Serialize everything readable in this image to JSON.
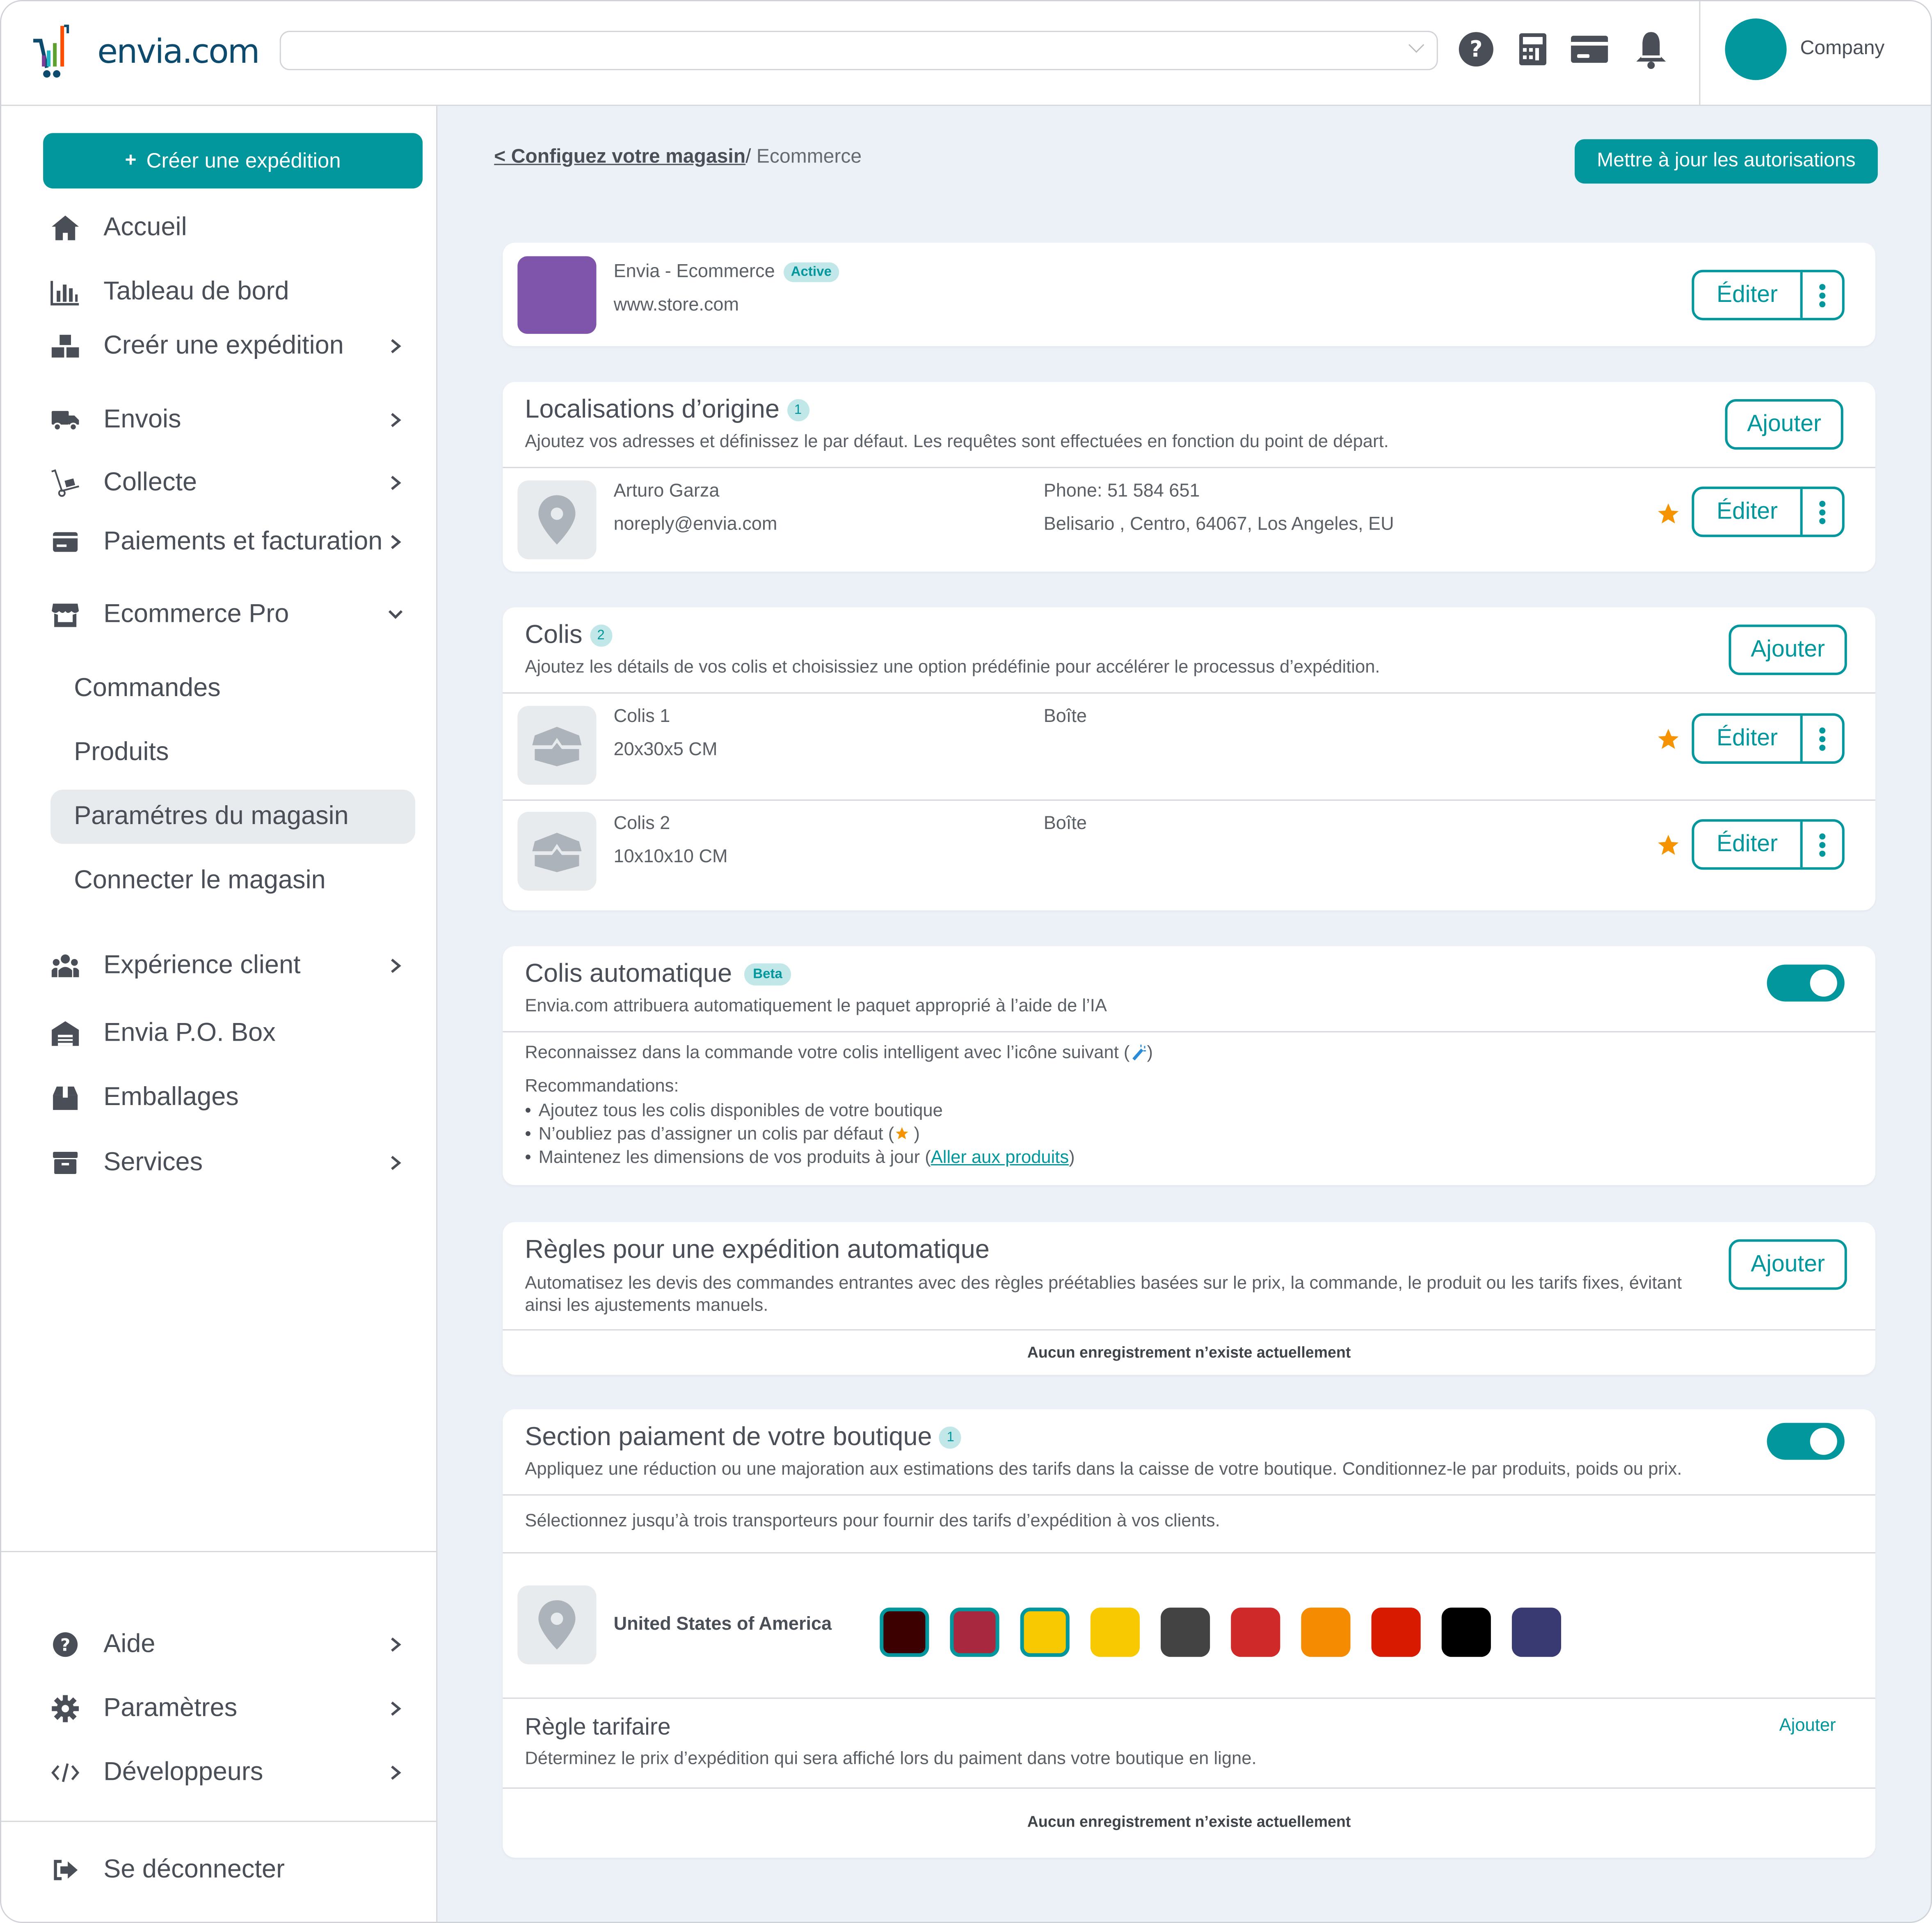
{
  "header": {
    "logo_text": "envia.com",
    "search": {
      "value": "",
      "placeholder": ""
    },
    "icons": [
      "help-circle-icon",
      "calculator-icon",
      "credit-card-icon",
      "bell-icon"
    ],
    "user_label": "Company",
    "avatar_color": "#02979c"
  },
  "sidebar": {
    "create_button": "Créer une expédition",
    "items": [
      {
        "label": "Accueil",
        "icon": "home-icon",
        "has_arrow": false
      },
      {
        "label": "Tableau de bord",
        "icon": "bar-chart-icon",
        "has_arrow": false
      },
      {
        "label": "Creér une expédition",
        "icon": "boxes-icon",
        "has_arrow": true
      },
      {
        "label": "Envois",
        "icon": "truck-icon",
        "has_arrow": true
      },
      {
        "label": "Collecte",
        "icon": "hand-truck-icon",
        "has_arrow": true
      },
      {
        "label": "Paiements et facturation",
        "icon": "credit-card-icon",
        "has_arrow": true
      },
      {
        "label": "Ecommerce Pro",
        "icon": "store-icon",
        "expanded": true
      }
    ],
    "sub_items": [
      {
        "label": "Commandes",
        "active": false
      },
      {
        "label": "Produits",
        "active": false
      },
      {
        "label": "Paramétres du magasin",
        "active": true
      },
      {
        "label": "Connecter le magasin",
        "active": false
      }
    ],
    "items_after": [
      {
        "label": "Expérience client",
        "icon": "users-icon",
        "has_arrow": true
      },
      {
        "label": "Envia P.O. Box",
        "icon": "warehouse-icon",
        "has_arrow": false
      },
      {
        "label": "Emballages",
        "icon": "package-icon",
        "has_arrow": false
      },
      {
        "label": "Services",
        "icon": "archive-icon",
        "has_arrow": true
      }
    ],
    "bottom_items": [
      {
        "label": "Aide",
        "icon": "help-circle-icon"
      },
      {
        "label": "Paramètres",
        "icon": "gear-icon"
      },
      {
        "label": "Développeurs",
        "icon": "code-icon"
      }
    ],
    "logout": "Se déconnecter"
  },
  "breadcrumb": {
    "back": "< Configuez votre magasin",
    "separator": "/ ",
    "current": "Ecommerce"
  },
  "update_permissions_button": "Mettre à jour les autorisations",
  "store": {
    "name": "Envia - Ecommerce",
    "status": "Active",
    "url": "www.store.com",
    "logo_color": "#7e55ab",
    "edit_label": "Éditer"
  },
  "origins": {
    "title": "Localisations d’origine",
    "count": "1",
    "description": "Ajoutez vos adresses et définissez le par défaut. Les requêtes sont effectuées en fonction du point de départ.",
    "add_label": "Ajouter",
    "rows": [
      {
        "name": "Arturo Garza",
        "email": "noreply@envia.com",
        "phone": "Phone: 51 584 651",
        "address": "Belisario , Centro, 64067, Los Angeles, EU",
        "default": true,
        "edit_label": "Éditer"
      }
    ]
  },
  "packages": {
    "title": "Colis",
    "count": "2",
    "description": "Ajoutez les détails de vos colis et choisissiez une option prédéfinie pour accélérer le processus d’expédition.",
    "add_label": "Ajouter",
    "rows": [
      {
        "name": "Colis 1",
        "dims": "20x30x5 CM",
        "type": "Boîte",
        "default": true,
        "edit_label": "Éditer"
      },
      {
        "name": "Colis 2",
        "dims": "10x10x10 CM",
        "type": "Boîte",
        "default": true,
        "edit_label": "Éditer"
      }
    ]
  },
  "auto_package": {
    "title": "Colis automatique",
    "badge": "Beta",
    "description": "Envia.com attribuera automatiquement le paquet approprié à l’aide de l’IA",
    "enabled": true,
    "recognize_text": "Reconnaissez dans la commande votre colis intelligent avec l’icône suivant (",
    "recognize_end": ")",
    "recs_title": "Recommandations:",
    "recs": [
      "Ajoutez tous les colis disponibles de votre boutique",
      "N’oubliez pas d’assigner un colis par défaut (",
      "Maintenez les dimensions de vos produits à jour  ("
    ],
    "recs_link": "Aller aux produits"
  },
  "auto_rules": {
    "title": "Règles pour une expédition automatique",
    "description": "Automatisez les devis des commandes entrantes avec des règles préétablies basées sur le prix, la commande, le produit ou les tarifs fixes, évitant ainsi les ajustements manuels.",
    "add_label": "Ajouter",
    "empty": "Aucun enregistrement n’existe actuellement"
  },
  "checkout": {
    "title": "Section paiament de votre boutique",
    "count": "1",
    "description": "Appliquez une réduction ou une majoration aux estimations des tarifs dans la caisse de votre boutique. Conditionnez-le par produits, poids ou prix.",
    "enabled": true,
    "carriers_hint": "Sélectionnez jusqu’à trois transporteurs pour fournir des tarifs d’expédition à vos clients.",
    "country": "United States of America",
    "carriers": [
      {
        "color": "#3d0000",
        "selected": true
      },
      {
        "color": "#a8283f",
        "selected": true
      },
      {
        "color": "#f8c800",
        "selected": true
      },
      {
        "color": "#f8c800",
        "selected": false
      },
      {
        "color": "#434343",
        "selected": false
      },
      {
        "color": "#d0292a",
        "selected": false
      },
      {
        "color": "#f58b00",
        "selected": false
      },
      {
        "color": "#d81b00",
        "selected": false
      },
      {
        "color": "#000000",
        "selected": false
      },
      {
        "color": "#3a3a73",
        "selected": false
      }
    ],
    "rate_rule_title": "Règle tarifaire",
    "rate_rule_description": "Déterminez le prix d’expédition qui sera affiché lors du paiment dans votre boutique en ligne.",
    "rate_rule_add": "Ajouter",
    "empty": "Aucun enregistrement n’existe actuellement"
  },
  "colors": {
    "accent": "#02979c",
    "star": "#f59300",
    "background": "#ecf0f7"
  }
}
